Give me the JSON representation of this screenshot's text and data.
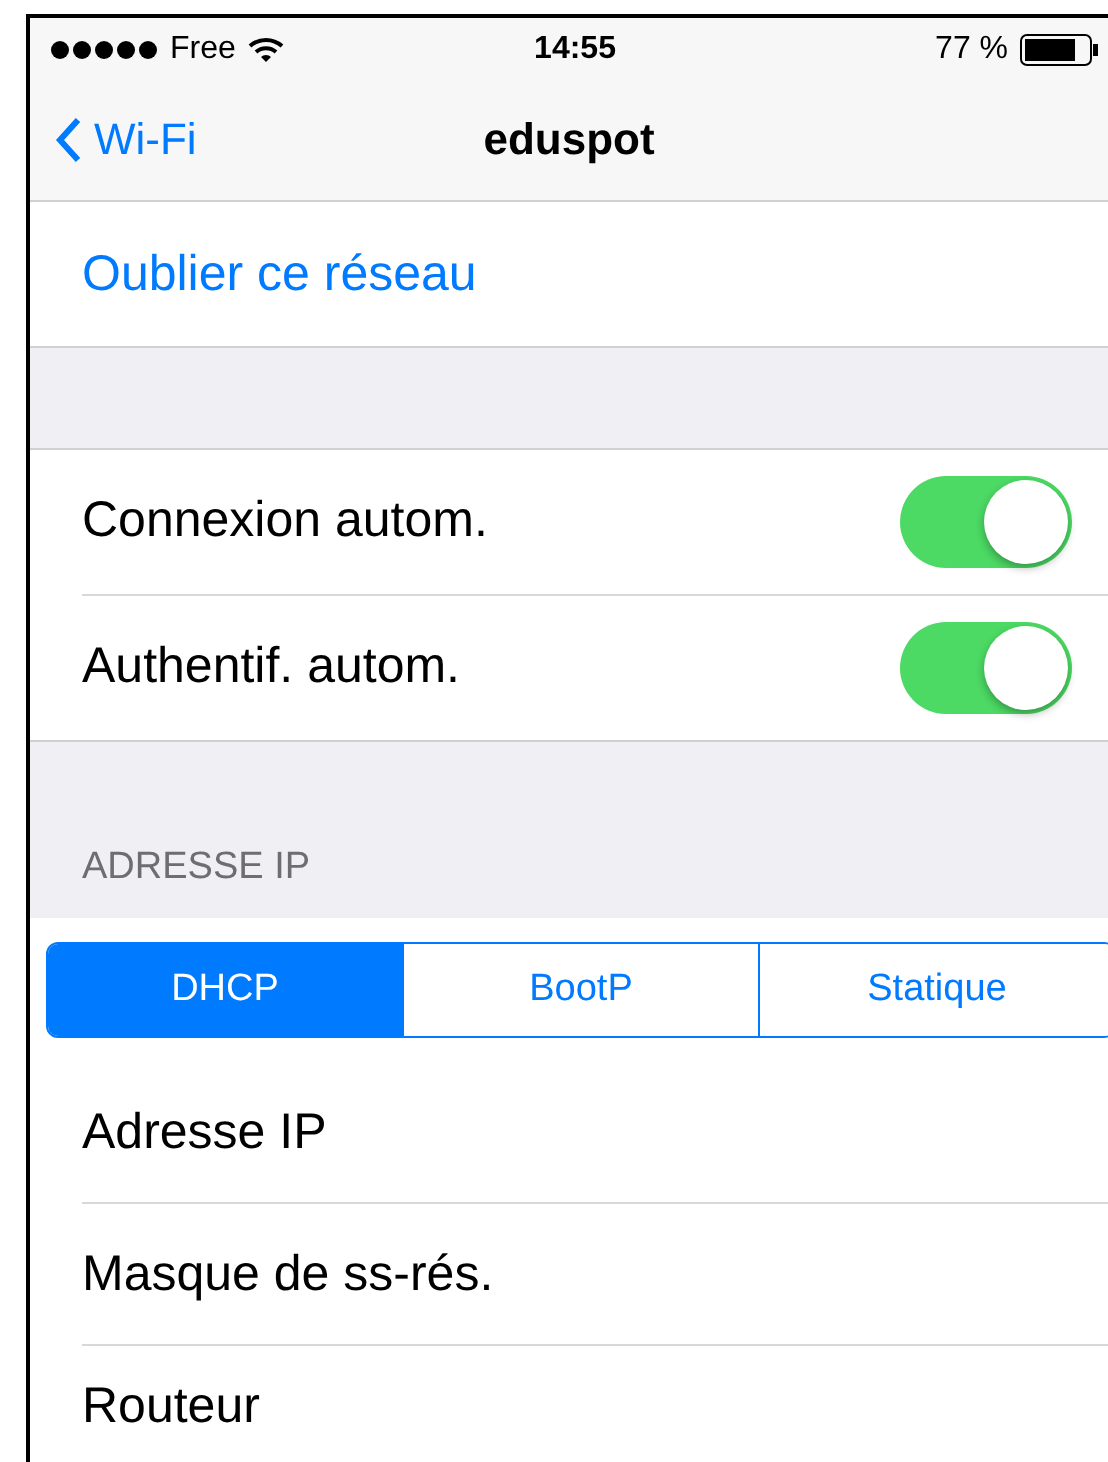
{
  "status_bar": {
    "carrier": "Free",
    "time": "14:55",
    "battery": "77 %"
  },
  "nav": {
    "back": "Wi-Fi",
    "title": "eduspot"
  },
  "forget": {
    "label": "Oublier ce réseau"
  },
  "toggles": [
    {
      "label": "Connexion autom.",
      "on": true
    },
    {
      "label": "Authentif. autom.",
      "on": true
    }
  ],
  "ip_section": {
    "header": "ADRESSE IP",
    "segments": [
      {
        "label": "DHCP",
        "selected": true
      },
      {
        "label": "BootP",
        "selected": false
      },
      {
        "label": "Statique",
        "selected": false
      }
    ],
    "rows": [
      {
        "label": "Adresse IP"
      },
      {
        "label": "Masque de ss-rés."
      },
      {
        "label": "Routeur"
      }
    ]
  }
}
